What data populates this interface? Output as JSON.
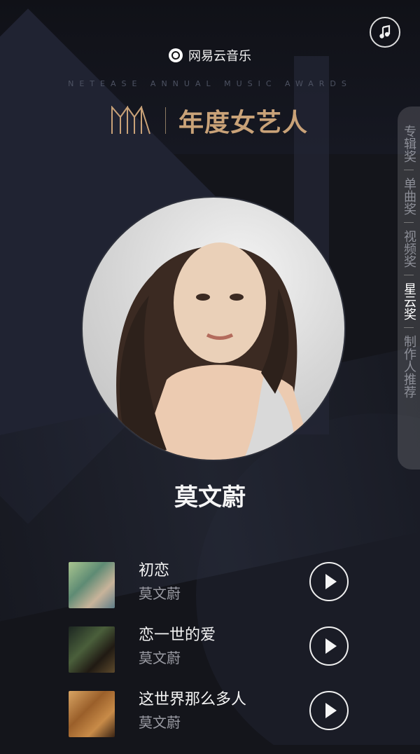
{
  "header": {
    "brand": "网易云音乐",
    "subtitle": "NETEASE ANNUAL MUSIC AWARDS",
    "award_title": "年度女艺人"
  },
  "side_nav": {
    "items": [
      {
        "label": "专辑奖",
        "active": false
      },
      {
        "label": "单曲奖",
        "active": false
      },
      {
        "label": "视频奖",
        "active": false
      },
      {
        "label": "星云奖",
        "active": true
      },
      {
        "label": "制作人推荐",
        "active": false
      }
    ]
  },
  "artist": {
    "name": "莫文蔚"
  },
  "songs": [
    {
      "title": "初恋",
      "artist": "莫文蔚"
    },
    {
      "title": "恋一世的爱",
      "artist": "莫文蔚"
    },
    {
      "title": "这世界那么多人",
      "artist": "莫文蔚"
    }
  ],
  "icons": {
    "music": "music-note-icon",
    "brand": "netease-cloud-music-icon",
    "play": "play-icon"
  },
  "colors": {
    "background": "#14151b",
    "accent_gold": "#c9a278"
  }
}
